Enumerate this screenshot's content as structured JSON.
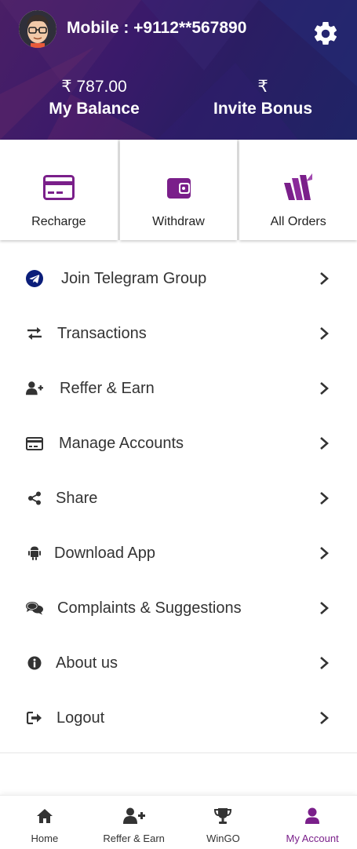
{
  "header": {
    "mobile_label": "Mobile : +9112**567890",
    "balance_amount": "₹ 787.00",
    "balance_label": "My Balance",
    "bonus_amount": "₹",
    "bonus_label": "Invite Bonus"
  },
  "actions": [
    {
      "label": "Recharge",
      "icon": "card-icon"
    },
    {
      "label": "Withdraw",
      "icon": "wallet-icon"
    },
    {
      "label": "All Orders",
      "icon": "orders-icon"
    }
  ],
  "menu": [
    {
      "label": "Join Telegram Group",
      "icon": "telegram-icon"
    },
    {
      "label": "Transactions",
      "icon": "exchange-icon"
    },
    {
      "label": "Reffer & Earn",
      "icon": "user-plus-icon"
    },
    {
      "label": "Manage Accounts",
      "icon": "credit-card-icon"
    },
    {
      "label": "Share",
      "icon": "share-icon"
    },
    {
      "label": "Download App",
      "icon": "android-icon"
    },
    {
      "label": "Complaints & Suggestions",
      "icon": "comments-icon"
    },
    {
      "label": "About us",
      "icon": "info-icon"
    },
    {
      "label": "Logout",
      "icon": "sign-out-icon"
    }
  ],
  "bottom_nav": [
    {
      "label": "Home",
      "icon": "home-icon"
    },
    {
      "label": "Reffer & Earn",
      "icon": "user-plus-icon"
    },
    {
      "label": "WinGO",
      "icon": "trophy-icon"
    },
    {
      "label": "My Account",
      "icon": "user-icon",
      "active": true
    }
  ],
  "colors": {
    "accent": "#7a1f8a",
    "header_start": "#4a1f66",
    "header_end": "#1f2466",
    "telegram": "#0b1e7a"
  }
}
